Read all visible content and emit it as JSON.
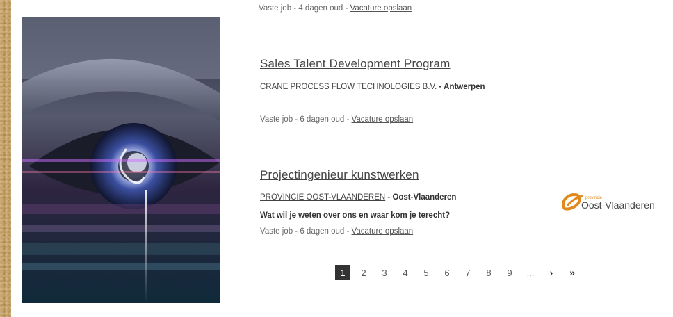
{
  "jobs": [
    {
      "meta": {
        "type": "Vaste job",
        "sep1": " - ",
        "age": "4 dagen oud",
        "sep2": " - ",
        "save": "Vacature opslaan"
      }
    },
    {
      "title": "Sales Talent Development Program",
      "company": "CRANE PROCESS FLOW TECHNOLOGIES B.V.",
      "location": " - Antwerpen",
      "meta": {
        "type": "Vaste job",
        "sep1": " - ",
        "age": "6 dagen oud",
        "sep2": " - ",
        "save": "Vacature opslaan"
      }
    },
    {
      "title": "Projectingenieur kunstwerken",
      "company": "PROVINCIE OOST-VLAANDEREN",
      "location": " - Oost-Vlaanderen",
      "teaser": "Wat wil je weten over ons en waar kom je terecht?",
      "logo": {
        "small": "provincie",
        "big": "Oost-Vlaanderen"
      },
      "meta": {
        "type": "Vaste job",
        "sep1": " - ",
        "age": "6 dagen oud",
        "sep2": " - ",
        "save": "Vacature opslaan"
      }
    }
  ],
  "pagination": {
    "pages": [
      "1",
      "2",
      "3",
      "4",
      "5",
      "6",
      "7",
      "8",
      "9"
    ],
    "active": "1",
    "ellipsis": "...",
    "next": "›",
    "last": "»"
  },
  "colors": {
    "accent_logo": "#e08a1e",
    "text": "#444444",
    "active_page": "#333333"
  },
  "icons": {
    "next": "chevron-right-icon",
    "last": "double-chevron-right-icon"
  }
}
